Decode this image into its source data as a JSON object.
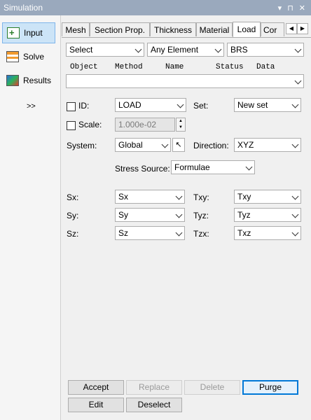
{
  "window": {
    "title": "Simulation",
    "controls": [
      "▾",
      "⊓",
      "✕"
    ]
  },
  "sidebar": {
    "items": [
      {
        "label": "Input",
        "active": true
      },
      {
        "label": "Solve",
        "active": false
      },
      {
        "label": "Results",
        "active": false
      }
    ],
    "more_label": ">>"
  },
  "tabs": [
    {
      "label": "Mesh"
    },
    {
      "label": "Section Prop."
    },
    {
      "label": "Thickness"
    },
    {
      "label": "Material"
    },
    {
      "label": "Load",
      "active": true
    },
    {
      "label": "Cor"
    }
  ],
  "filters": {
    "select": "Select",
    "element": "Any Element",
    "type": "BRS"
  },
  "columns": {
    "object": "Object",
    "method": "Method",
    "name": "Name",
    "status": "Status",
    "data": "Data"
  },
  "list_value": "",
  "form": {
    "id_label": "ID:",
    "id_value": "LOAD",
    "set_label": "Set:",
    "set_value": "New set",
    "scale_label": "Scale:",
    "scale_value": "1.000e-02",
    "system_label": "System:",
    "system_value": "Global",
    "direction_label": "Direction:",
    "direction_value": "XYZ",
    "stress_source_label": "Stress Source:",
    "stress_source_value": "Formulae",
    "sx_label": "Sx:",
    "sx_value": "Sx",
    "sy_label": "Sy:",
    "sy_value": "Sy",
    "sz_label": "Sz:",
    "sz_value": "Sz",
    "txy_label": "Txy:",
    "txy_value": "Txy",
    "tyz_label": "Tyz:",
    "tyz_value": "Tyz",
    "tzx_label": "Tzx:",
    "tzx_value": "Txz"
  },
  "buttons": {
    "accept": "Accept",
    "replace": "Replace",
    "delete": "Delete",
    "purge": "Purge",
    "edit": "Edit",
    "deselect": "Deselect"
  }
}
